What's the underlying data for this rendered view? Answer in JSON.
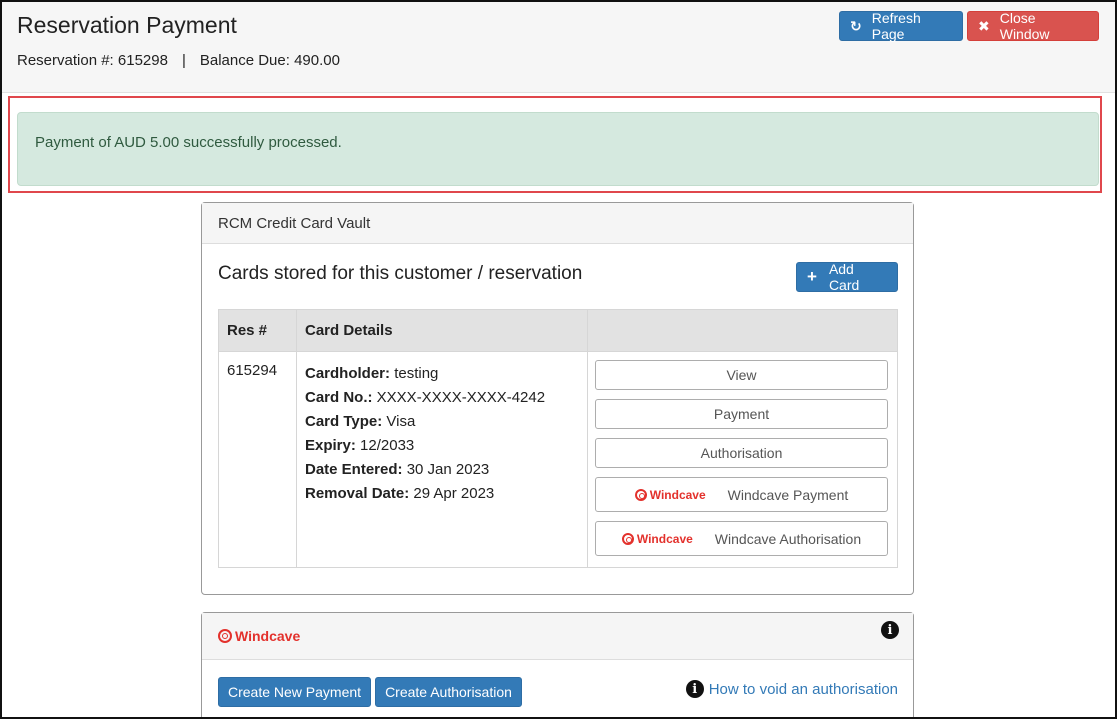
{
  "header": {
    "title": "Reservation Payment",
    "reservation_label": "Reservation #: 615298",
    "separator": "|",
    "balance_label": "Balance Due: 490.00",
    "refresh_label": "Refresh Page",
    "close_label": "Close Window"
  },
  "alert": {
    "message": "Payment of AUD 5.00 successfully processed."
  },
  "vault": {
    "heading": "RCM Credit Card Vault",
    "cards_title": "Cards stored for this customer / reservation",
    "add_card_label": "Add Card",
    "columns": [
      "Res #",
      "Card Details",
      ""
    ],
    "rows": [
      {
        "res": "615294",
        "details": [
          {
            "label": "Cardholder:",
            "value": "testing"
          },
          {
            "label": "Card No.:",
            "value": "XXXX-XXXX-XXXX-4242"
          },
          {
            "label": "Card Type:",
            "value": "Visa"
          },
          {
            "label": "Expiry:",
            "value": "12/2033"
          },
          {
            "label": "Date Entered:",
            "value": "30 Jan 2023"
          },
          {
            "label": "Removal Date:",
            "value": "29 Apr 2023"
          }
        ],
        "actions": {
          "view": "View",
          "payment": "Payment",
          "authorisation": "Authorisation",
          "windcave_payment": "Windcave Payment",
          "windcave_authorisation": "Windcave Authorisation"
        }
      }
    ]
  },
  "windcave": {
    "logo_text": "Windcave",
    "create_payment_label": "Create New Payment",
    "create_authorisation_label": "Create Authorisation",
    "void_link_label": "How to void an authorisation"
  },
  "colors": {
    "primary": "#337ab7",
    "danger": "#d9534f",
    "success_bg": "#d5e9df",
    "windcave_red": "#e3312c"
  },
  "icons": {
    "refresh": "refresh-icon",
    "close": "close-icon",
    "add": "plus-icon",
    "info": "info-icon",
    "windcave": "windcave-logo"
  }
}
